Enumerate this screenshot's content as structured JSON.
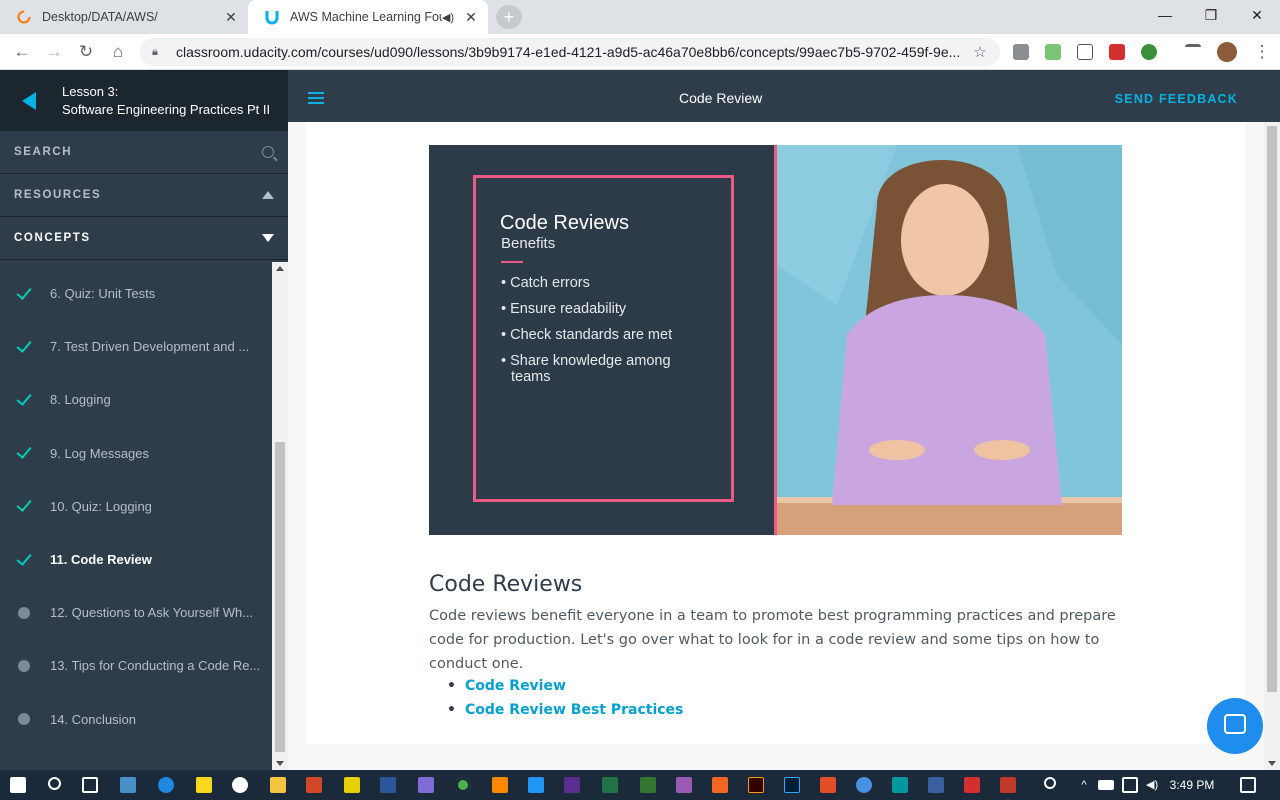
{
  "browser": {
    "tabs": [
      {
        "title": "Desktop/DATA/AWS/",
        "active": false
      },
      {
        "title": "AWS Machine Learning Foun",
        "active": true
      }
    ],
    "url": "classroom.udacity.com/courses/ud090/lessons/3b9b9174-e1ed-4121-a9d5-ac46a70e8bb6/concepts/99aec7b5-9702-459f-9e..."
  },
  "sidebar": {
    "lesson_number": "Lesson 3:",
    "lesson_title": "Software Engineering Practices Pt II",
    "search_label": "SEARCH",
    "resources_label": "RESOURCES",
    "concepts_label": "CONCEPTS",
    "concepts": [
      {
        "label": "6. Quiz: Unit Tests",
        "status": "done"
      },
      {
        "label": "7. Test Driven Development and ...",
        "status": "done"
      },
      {
        "label": "8. Logging",
        "status": "done"
      },
      {
        "label": "9. Log Messages",
        "status": "done"
      },
      {
        "label": "10. Quiz: Logging",
        "status": "done"
      },
      {
        "label": "11. Code Review",
        "status": "current"
      },
      {
        "label": "12. Questions to Ask Yourself Wh...",
        "status": "todo"
      },
      {
        "label": "13. Tips for Conducting a Code Re...",
        "status": "todo"
      },
      {
        "label": "14. Conclusion",
        "status": "todo"
      }
    ]
  },
  "header": {
    "title": "Code Review",
    "feedback": "SEND FEEDBACK"
  },
  "video": {
    "slide_title": "Code Reviews",
    "slide_subtitle": "Benefits",
    "bullets": [
      "Catch errors",
      "Ensure readability",
      "Check standards are met",
      "Share knowledge among teams"
    ]
  },
  "content": {
    "heading": "Code Reviews",
    "paragraph": "Code reviews benefit everyone in a team to promote best programming practices and prepare code for production. Let's go over what to look for in a code review and some tips on how to conduct one.",
    "links": [
      "Code Review",
      "Code Review Best Practices"
    ]
  },
  "taskbar": {
    "time": "3:49 PM"
  },
  "colors": {
    "accent": "#02b3e4",
    "sidebar_bg": "#2e3d49",
    "check": "#02ccba",
    "slide_border": "#ea5a82"
  }
}
